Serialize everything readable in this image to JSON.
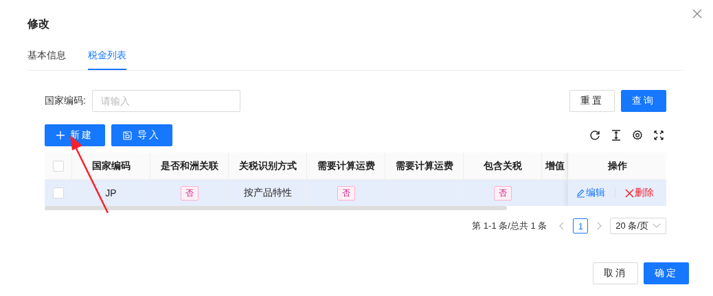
{
  "dialog": {
    "title": "修改"
  },
  "tabs": [
    {
      "label": "基本信息",
      "selected": false
    },
    {
      "label": "税金列表",
      "selected": true
    }
  ],
  "search": {
    "label": "国家编码:",
    "placeholder": "请输入",
    "buttons": [
      {
        "label": "重置",
        "kind": "default"
      },
      {
        "label": "查询",
        "kind": "primary"
      }
    ]
  },
  "toolbar": {
    "buttons": [
      {
        "label": "新建",
        "kind": "add"
      },
      {
        "label": "导入",
        "kind": "import"
      }
    ]
  },
  "table": {
    "all_checked": false,
    "columns": [
      "国家编码",
      "是否和洲关联",
      "关税识别方式",
      "需要计算运费",
      "需要计算运费",
      "包含关税",
      "增值",
      "操作"
    ],
    "rows": [
      {
        "checked": false,
        "cells": [
          {
            "kind": "text",
            "text": "JP"
          },
          {
            "kind": "tag",
            "text": "否"
          },
          {
            "kind": "text",
            "text": "按产品特性"
          },
          {
            "kind": "tag",
            "text": "否"
          },
          {
            "kind": "empty"
          },
          {
            "kind": "tag",
            "text": "否"
          },
          {
            "kind": "empty"
          }
        ],
        "actions": [
          {
            "kind": "edit",
            "label": "编辑"
          },
          {
            "kind": "delete",
            "label": "删除"
          }
        ]
      }
    ]
  },
  "pagination": {
    "summary": "第 1-1 条/总共 1 条",
    "pages": [
      {
        "label": "1",
        "selected": true
      }
    ],
    "page_size": "20 条/页"
  },
  "footer": {
    "buttons": [
      {
        "label": "取消",
        "kind": "default"
      },
      {
        "label": "确定",
        "kind": "primary"
      }
    ]
  }
}
